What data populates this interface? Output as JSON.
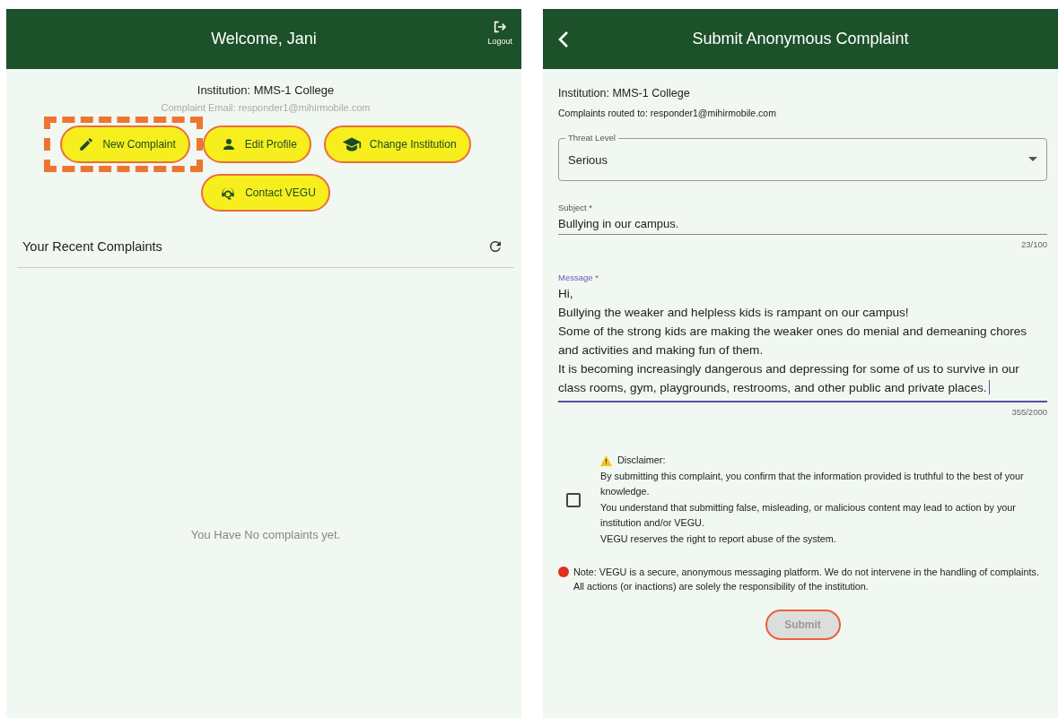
{
  "home_screen": {
    "header": {
      "title": "Welcome, Jani",
      "logout_label": "Logout"
    },
    "institution": "Institution: MMS-1 College",
    "complaint_email": "Complaint Email: responder1@mihirmobile.com",
    "actions": [
      {
        "label": "New Complaint",
        "kind": "pencil",
        "highlighted": true
      },
      {
        "label": "Edit Profile",
        "kind": "person",
        "highlighted": false
      },
      {
        "label": "Change Institution",
        "kind": "school",
        "highlighted": false
      },
      {
        "label": "Contact VEGU",
        "kind": "support",
        "highlighted": false
      }
    ],
    "recent": {
      "title": "Your Recent Complaints",
      "empty_message": "You Have No complaints yet."
    }
  },
  "complaint_form": {
    "header": {
      "title": "Submit Anonymous Complaint"
    },
    "institution": "Institution: MMS-1 College",
    "routed_to": "Complaints routed to: responder1@mihirmobile.com",
    "threat_level": {
      "label": "Threat Level",
      "value": "Serious"
    },
    "subject": {
      "label": "Subject *",
      "value": "Bullying in our campus.",
      "counter": "23/100",
      "focused": false
    },
    "message": {
      "label": "Message *",
      "value": "Hi,\nBullying the weaker and helpless kids is rampant on our campus!\nSome of the strong kids are making the weaker ones do menial and demeaning chores and activities and making fun of them.\nIt is becoming increasingly dangerous and depressing for some of us to survive in our class rooms, gym, playgrounds, restrooms, and other public and private places.",
      "counter": "355/2000",
      "focused": true
    },
    "disclaimer": {
      "checked": false,
      "title": "Disclaimer:",
      "lines": [
        "By submitting this complaint, you confirm that the information provided is truthful to the best of your knowledge.",
        "You understand that submitting false, misleading, or malicious content may lead to action by your institution and/or VEGU.",
        "VEGU reserves the right to report abuse of the system."
      ]
    },
    "note": "Note: VEGU is a secure, anonymous messaging platform. We do not intervene in the handling of complaints. All actions (or inactions) are solely the responsibility of the institution.",
    "submit": {
      "label": "Submit",
      "disabled": true
    }
  }
}
